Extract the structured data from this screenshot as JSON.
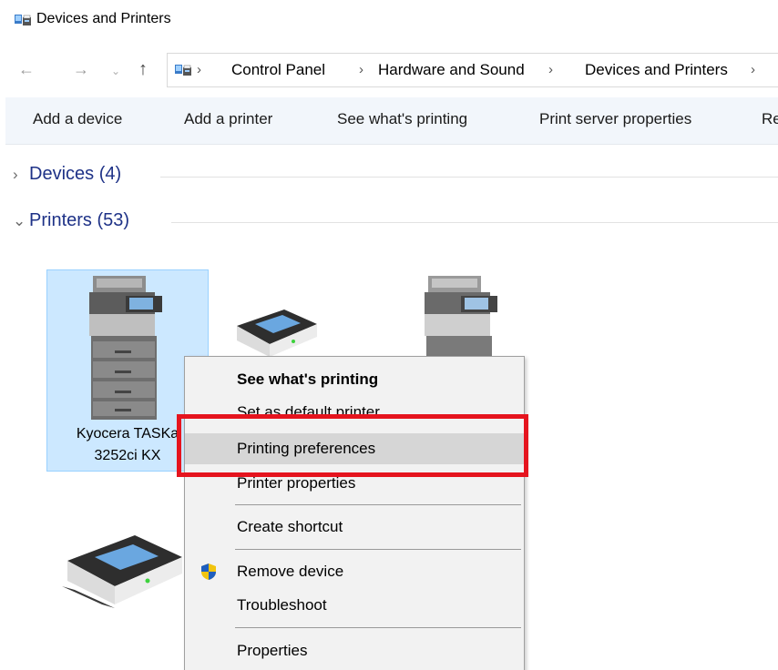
{
  "window": {
    "title": "Devices and Printers",
    "icon": "devices-printers-icon"
  },
  "nav": {
    "back": "←",
    "forward": "→",
    "recent": "⌄",
    "up": "↑"
  },
  "breadcrumb": {
    "items": [
      "Control Panel",
      "Hardware and Sound",
      "Devices and Printers"
    ],
    "separator": "›"
  },
  "toolbar": {
    "add_device": "Add a device",
    "add_printer": "Add a printer",
    "see_printing": "See what's printing",
    "print_server": "Print server properties",
    "overflow": "Re"
  },
  "groups": {
    "devices": {
      "label": "Devices (4)",
      "expanded": false
    },
    "printers": {
      "label": "Printers (53)",
      "expanded": true
    }
  },
  "printers": {
    "selected": {
      "line1": "Kyocera TASKa",
      "line2": "3252ci KX"
    }
  },
  "context_menu": {
    "see_printing": "See what's printing",
    "set_default": "Set as default printer",
    "printing_prefs": "Printing preferences",
    "printer_props": "Printer properties",
    "create_shortcut": "Create shortcut",
    "remove_device": "Remove device",
    "troubleshoot": "Troubleshoot",
    "properties": "Properties"
  },
  "colors": {
    "accent_link": "#1e3287",
    "selection_fill": "#cce8ff",
    "highlight_red": "#e5141e",
    "menu_bg": "#f2f2f2"
  }
}
